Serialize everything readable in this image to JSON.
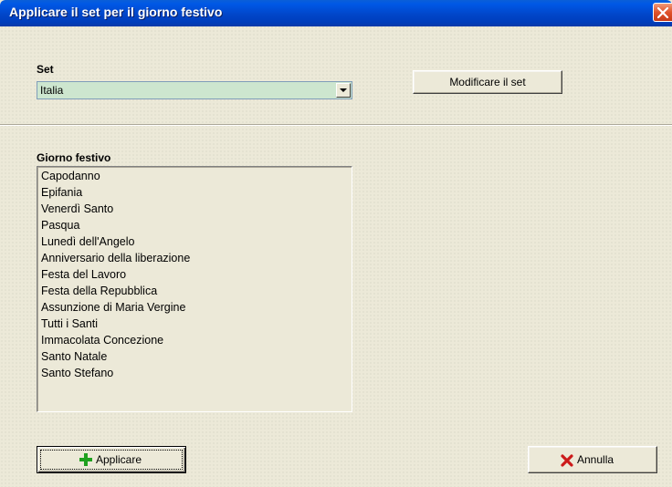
{
  "window": {
    "title": "Applicare il set per il giorno festivo"
  },
  "set_section": {
    "label": "Set",
    "selected_value": "Italia",
    "edit_button": "Modificare il set"
  },
  "holiday_section": {
    "label": "Giorno festivo",
    "items": [
      "Capodanno",
      "Epifania",
      "Venerdì Santo",
      "Pasqua",
      "Lunedì dell'Angelo",
      "Anniversario della liberazione",
      "Festa del Lavoro",
      "Festa della Repubblica",
      "Assunzione di Maria Vergine",
      "Tutti i Santi",
      "Immacolata Concezione",
      "Santo Natale",
      "Santo Stefano"
    ]
  },
  "footer": {
    "apply_button": "Applicare",
    "cancel_button": "Annulla"
  },
  "colors": {
    "title_bar": "#0054e3",
    "combo_background": "#cde6cf",
    "apply_icon": "#1fa01f",
    "cancel_icon": "#cc1a1a"
  },
  "icons": {
    "apply": "plus-icon",
    "cancel": "x-icon",
    "close": "close-icon"
  }
}
